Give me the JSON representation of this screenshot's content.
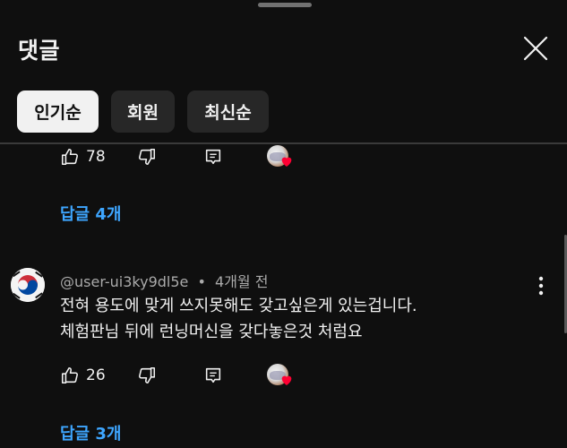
{
  "header": {
    "title": "댓글"
  },
  "sort_chips": [
    {
      "label": "인기순",
      "selected": true
    },
    {
      "label": "회원"
    },
    {
      "label": "최신순"
    }
  ],
  "comments": [
    {
      "like_count": "78",
      "replies_label": "답글 4개",
      "creator_hearted": true
    },
    {
      "author": "@user-ui3ky9dl5e",
      "separator": "•",
      "time": "4개월 전",
      "text_lines": [
        "전혀 용도에 맞게 쓰지못해도 갖고싶은게 있는겁니다.",
        "체험판님 뒤에 런닝머신을 갖다놓은것 처럼요"
      ],
      "like_count": "26",
      "replies_label": "답글 3개",
      "creator_hearted": true
    }
  ],
  "colors": {
    "background": "#0f0f0f",
    "link": "#3ea6ff",
    "heart": "#ff0033"
  },
  "icons": [
    "close-icon",
    "like-icon",
    "dislike-icon",
    "reply-icon",
    "more-vert-icon",
    "heart-icon"
  ]
}
